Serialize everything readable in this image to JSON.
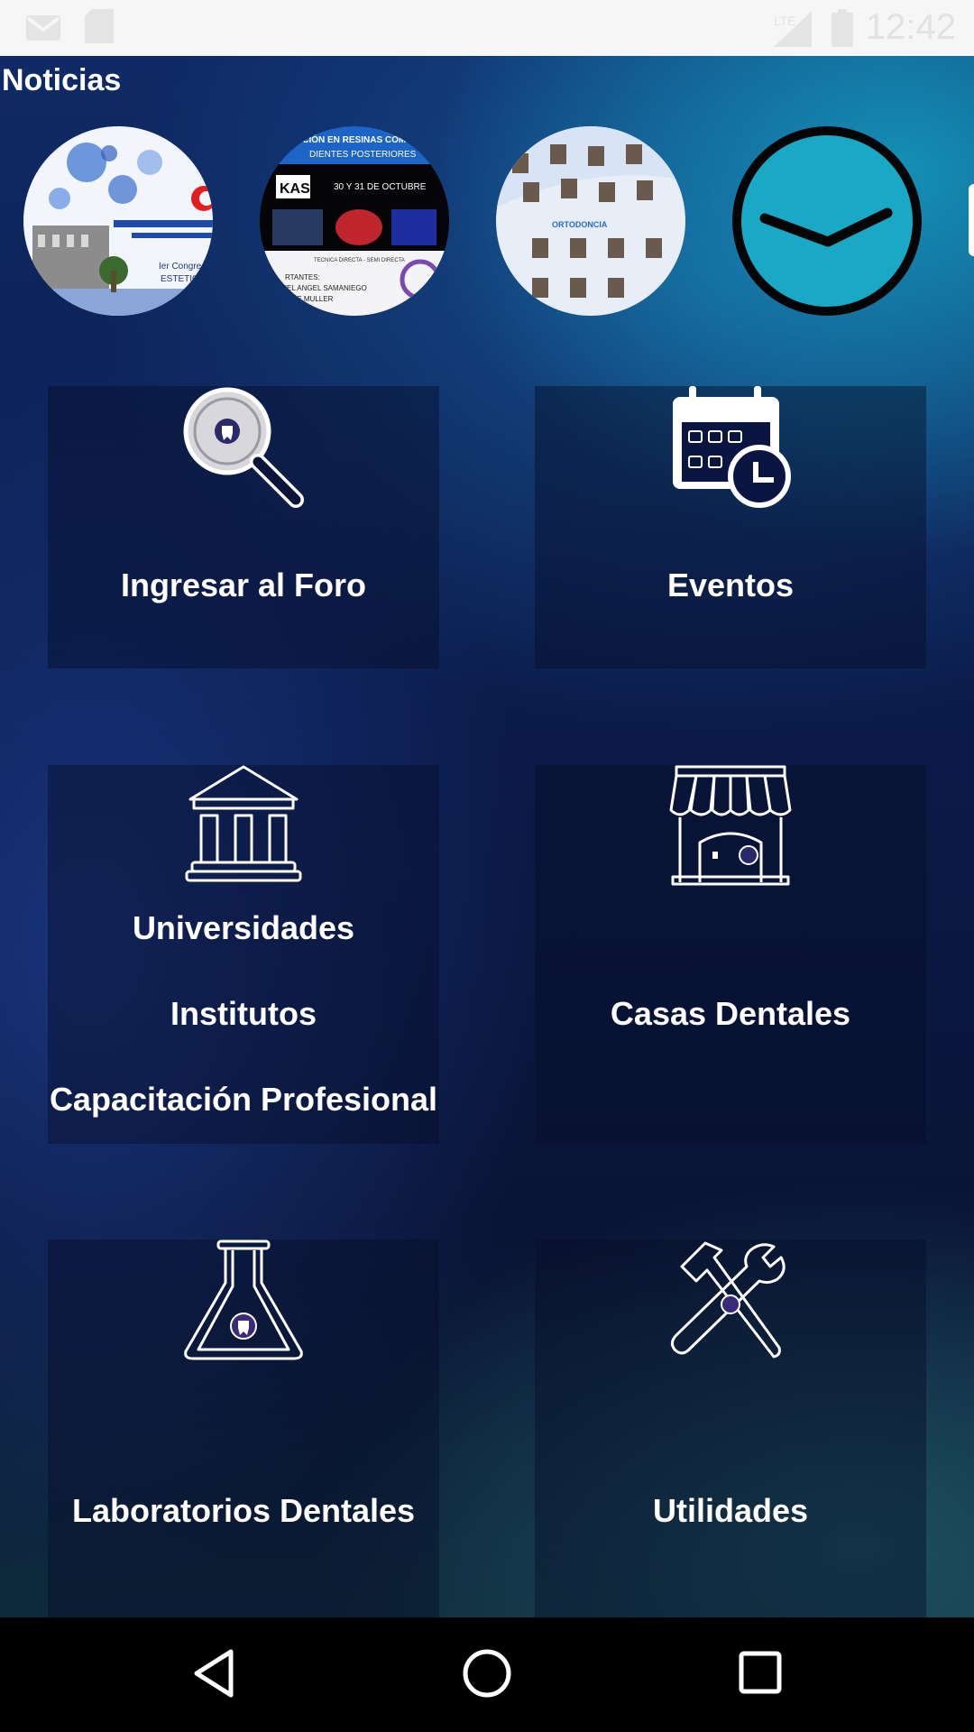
{
  "status_bar": {
    "time": "12:42",
    "icons": [
      "gmail-icon",
      "sd-card-icon",
      "lte-signal-icon",
      "battery-icon"
    ]
  },
  "news": {
    "title": "Noticias",
    "items": [
      {
        "name": "news-congreso-estetica",
        "caption": "Ier Congreso ESTETICA"
      },
      {
        "name": "news-resinas",
        "caption": "ACIÓN EN RESINAS COM DIENTES POSTERIORES",
        "date": "30 Y 31 DE OCTUBRE",
        "brand": "KAS",
        "footer": "GUEL ANGEL SAMANIEGO · ANIE MULLER"
      },
      {
        "name": "news-ortodoncia",
        "caption": "ORTODONCIA"
      },
      {
        "name": "news-clock",
        "caption": ""
      }
    ]
  },
  "menu": {
    "forum": {
      "label": "Ingresar al Foro",
      "icon": "search-tooth-icon"
    },
    "events": {
      "label": "Eventos",
      "icon": "calendar-clock-icon"
    },
    "universities": {
      "line1": "Universidades",
      "line2": "Institutos",
      "line3": "Capacitación Profesional",
      "icon": "university-icon"
    },
    "dental_houses": {
      "label": "Casas Dentales",
      "icon": "store-icon"
    },
    "labs": {
      "label": "Laboratorios Dentales",
      "icon": "flask-icon"
    },
    "utilities": {
      "label": "Utilidades",
      "icon": "tools-icon"
    }
  },
  "colors": {
    "accent_cyan": "#1aa8c4",
    "background_navy": "#0b1636",
    "tile": "#0a1230"
  }
}
